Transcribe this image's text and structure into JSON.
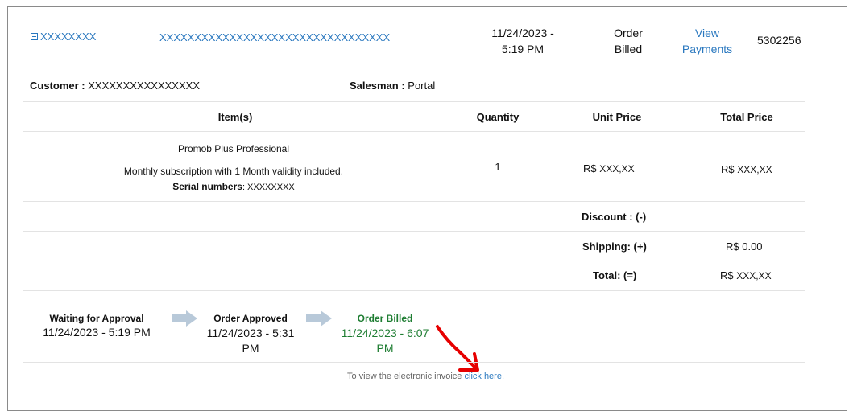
{
  "order": {
    "number": "XXXXXXXX",
    "description": "XXXXXXXXXXXXXXXXXXXXXXXXXXXXXXXXX",
    "date": "11/24/2023 - 5:19 PM",
    "status": "Order Billed",
    "view_payments": "View Payments",
    "id": "5302256"
  },
  "customer": {
    "label": "Customer :",
    "value": "XXXXXXXXXXXXXXXX"
  },
  "salesman": {
    "label": "Salesman :",
    "value": "Portal"
  },
  "table": {
    "headers": {
      "items": "Item(s)",
      "quantity": "Quantity",
      "unit_price": "Unit Price",
      "total_price": "Total Price"
    },
    "row": {
      "product": "Promob Plus Professional",
      "subscription": "Monthly subscription with 1 Month validity included.",
      "serial_label": "Serial numbers",
      "serial_value": ": XXXXXXXX",
      "quantity": "1",
      "unit_currency": "R$",
      "unit_value": "XXX,XX",
      "total_currency": "R$",
      "total_value": "XXX,XX"
    },
    "discount": {
      "label": "Discount : (-)",
      "value": ""
    },
    "shipping": {
      "label": "Shipping: (+)",
      "value": "R$ 0.00"
    },
    "total": {
      "label": "Total: (=)",
      "currency": "R$",
      "value": "XXX,XX"
    }
  },
  "timeline": [
    {
      "title": "Waiting for Approval",
      "date": "11/24/2023 - 5:19 PM"
    },
    {
      "title": "Order Approved",
      "date": "11/24/2023 - 5:31 PM"
    },
    {
      "title": "Order Billed",
      "date": "11/24/2023 - 6:07 PM"
    }
  ],
  "invoice": {
    "text": "To view the electronic invoice",
    "link": "click here."
  },
  "colors": {
    "link": "#2a78bf",
    "active_step": "#1e7d32",
    "arrow": "#b8c9d9",
    "annotation": "#e60000"
  }
}
